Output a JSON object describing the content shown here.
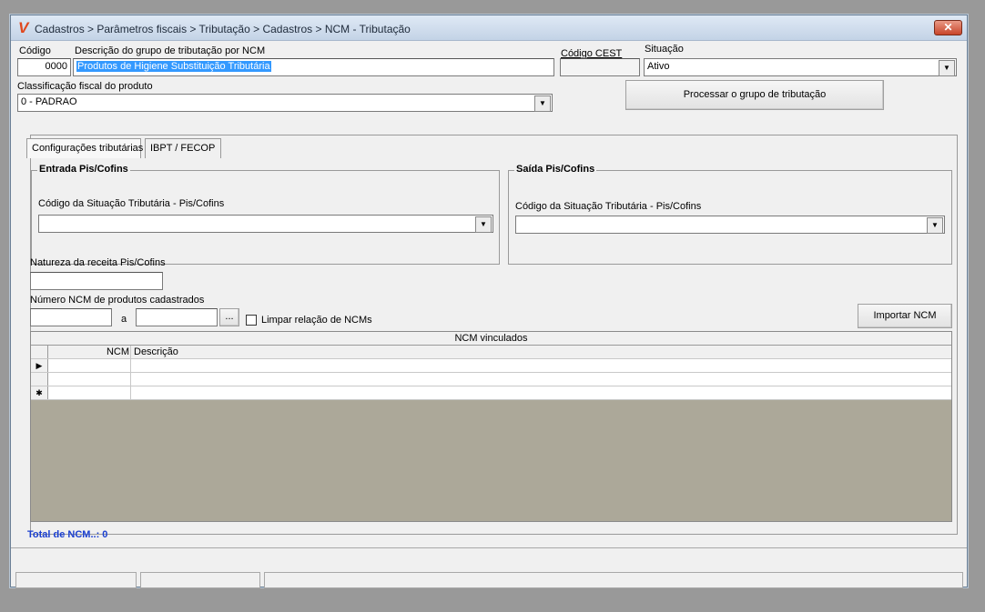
{
  "window": {
    "title": "Cadastros > Parâmetros fiscais > Tributação > Cadastros > NCM - Tributação",
    "close_symbol": "✕"
  },
  "form": {
    "codigo_label": "Código",
    "codigo_value": "0000",
    "descricao_label": "Descrição do grupo de tributação por NCM",
    "descricao_value": "Produtos de Higiene Substituição Tributária",
    "cest_label": "Código CEST",
    "cest_value": "",
    "situacao_label": "Situação",
    "situacao_value": "Ativo",
    "classificacao_label": "Classificação fiscal do produto",
    "classificacao_value": "0 - PADRAO",
    "processar_button": "Processar o grupo de tributação"
  },
  "tabs": [
    {
      "label": "Configurações tributárias",
      "active": true
    },
    {
      "label": "IBPT / FECOP",
      "active": false
    }
  ],
  "entrada": {
    "title": "Entrada Pis/Cofins",
    "cst_label": "Código da Situação Tributária - Pis/Cofins",
    "cst_value": ""
  },
  "saida": {
    "title": "Saída Pis/Cofins",
    "cst_label": "Código da Situação Tributária - Pis/Cofins",
    "cst_value": ""
  },
  "natureza": {
    "label": "Natureza da receita Pis/Cofins",
    "value": ""
  },
  "ncm_range": {
    "label": "Número  NCM de produtos cadastrados",
    "from_value": "",
    "separator": "a",
    "to_value": "",
    "browse_button": "...",
    "limpar_label": "Limpar relação de NCMs",
    "limpar_checked": false,
    "importar_button": "Importar NCM"
  },
  "grid": {
    "caption": "NCM vinculados",
    "columns": [
      "NCM",
      "Descrição"
    ],
    "current_row_indicator": "▶",
    "new_row_indicator": "✱"
  },
  "footer": {
    "total_text": "Total de NCM..: 0",
    "total_color": "#1a3fd0"
  }
}
